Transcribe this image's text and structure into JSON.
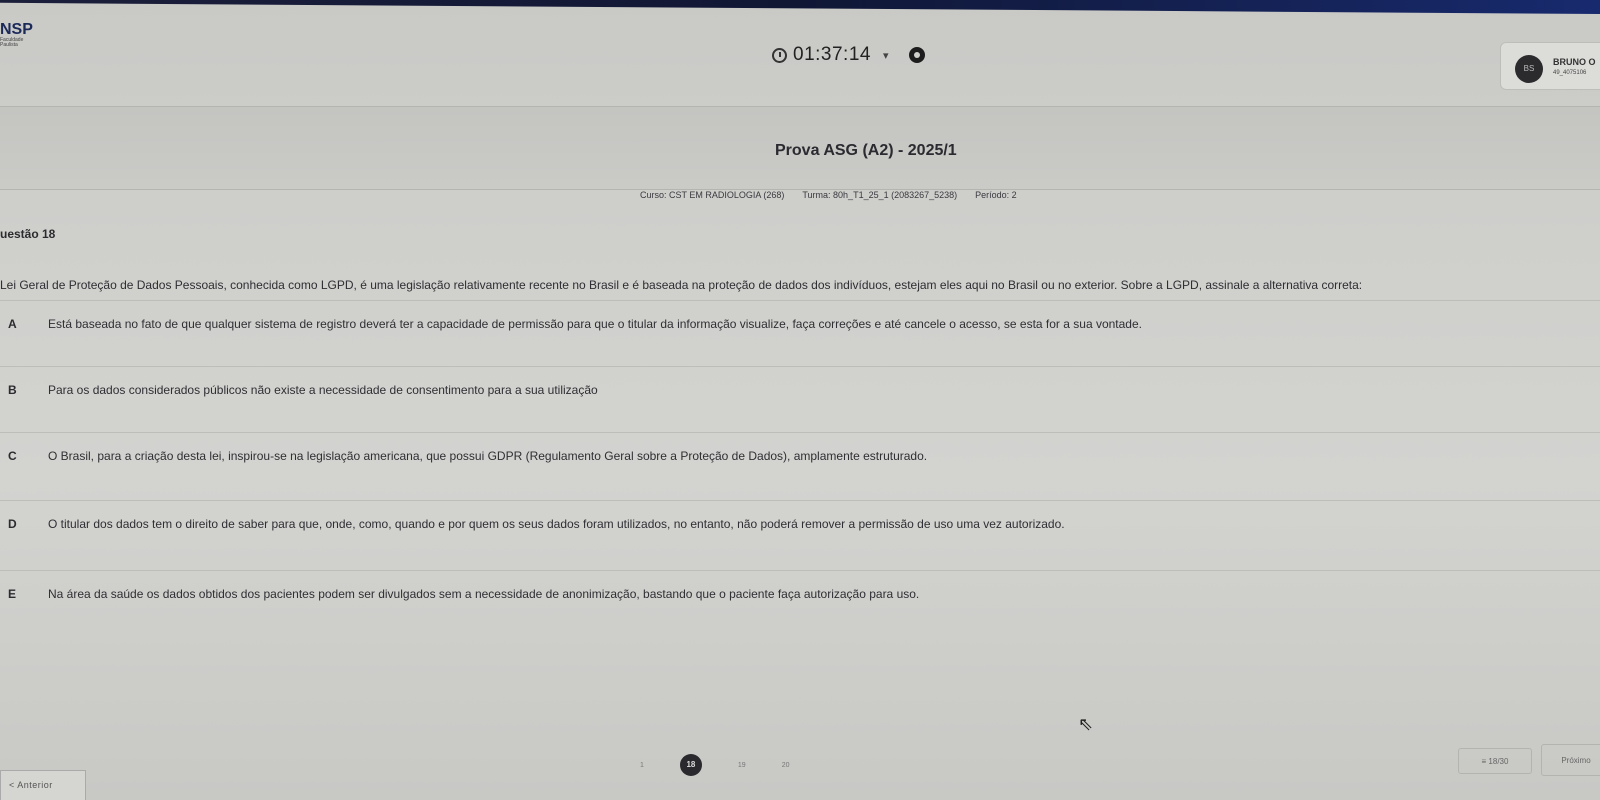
{
  "header": {
    "logo_text": "NSP",
    "logo_subtext": "Faculdade Paulista",
    "timer": "01:37:14",
    "user": {
      "initials": "BS",
      "name": "BRUNO O",
      "id": "49_4075106"
    }
  },
  "exam": {
    "title": "Prova ASG (A2) - 2025/1",
    "course": "Curso: CST EM RADIOLOGIA (268)",
    "class": "Turma: 80h_T1_25_1 (2083267_5238)",
    "period": "Período: 2"
  },
  "question": {
    "label": "uestão 18",
    "text": "Lei Geral de Proteção de Dados Pessoais, conhecida como LGPD, é uma legislação relativamente recente no Brasil e é baseada na proteção de dados dos indivíduos, estejam eles aqui no Brasil ou no exterior. Sobre a LGPD, assinale a alternativa correta:",
    "options": [
      {
        "letter": "A",
        "text": "Está baseada no fato de que qualquer sistema de registro deverá ter a capacidade de permissão para que o titular da informação visualize, faça correções e até cancele o acesso, se esta for a sua vontade."
      },
      {
        "letter": "B",
        "text": "Para os dados considerados públicos não existe a necessidade de consentimento para a sua utilização"
      },
      {
        "letter": "C",
        "text": "O Brasil, para a criação desta lei, inspirou-se na legislação americana, que possui GDPR (Regulamento Geral sobre a Proteção de Dados), amplamente estruturado."
      },
      {
        "letter": "D",
        "text": "O titular dos dados tem o direito de saber para que, onde, como, quando e por quem os seus dados foram utilizados, no entanto, não poderá remover a permissão de uso uma vez autorizado."
      },
      {
        "letter": "E",
        "text": "Na área da saúde os dados obtidos dos pacientes podem ser divulgados sem a necessidade de anonimização, bastando que o paciente faça autorização para uso."
      }
    ]
  },
  "footer": {
    "prev_label": "< Anterior",
    "pages": [
      "1",
      "18",
      "19",
      "20"
    ],
    "current_page": "18",
    "count": "18/30",
    "next_label": "Próximo"
  }
}
